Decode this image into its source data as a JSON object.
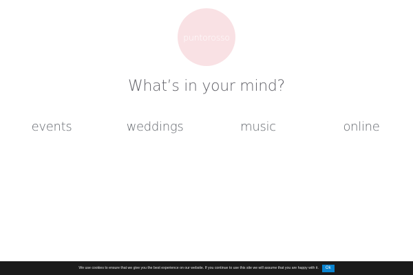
{
  "logo": {
    "word_1": "punto",
    "word_2": "rosso",
    "background_color": "#f9e1e4"
  },
  "headline": "What’s in your mind?",
  "nav": {
    "items": [
      {
        "label": "events"
      },
      {
        "label": "weddings"
      },
      {
        "label": "music"
      },
      {
        "label": "online"
      }
    ]
  },
  "cookie_notice": {
    "text": "We use cookies to ensure that we give you the best experience on our website. If you continue to use this site we will assume that you are happy with it.",
    "ok_label": "Ok",
    "bar_color": "#1b1b1b",
    "button_color": "#0a84d0"
  }
}
